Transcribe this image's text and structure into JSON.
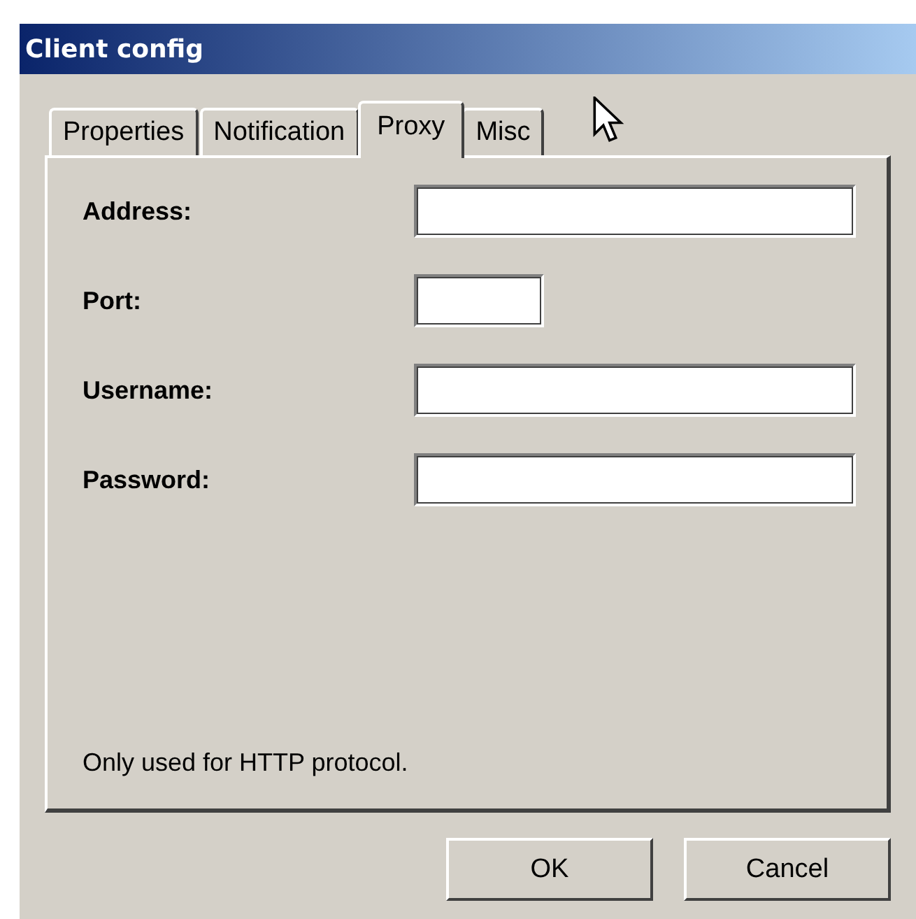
{
  "window": {
    "title": "Client config"
  },
  "tabs": [
    {
      "label": "Properties",
      "selected": false
    },
    {
      "label": "Notification",
      "selected": false
    },
    {
      "label": "Proxy",
      "selected": true
    },
    {
      "label": "Misc",
      "selected": false
    }
  ],
  "fields": [
    {
      "label": "Address:",
      "kind": "text"
    },
    {
      "label": "Port:",
      "kind": "port"
    },
    {
      "label": "Username:",
      "kind": "text"
    },
    {
      "label": "Password:",
      "kind": "text"
    }
  ],
  "note": "Only used for HTTP protocol.",
  "buttons": [
    "OK",
    "Cancel"
  ]
}
